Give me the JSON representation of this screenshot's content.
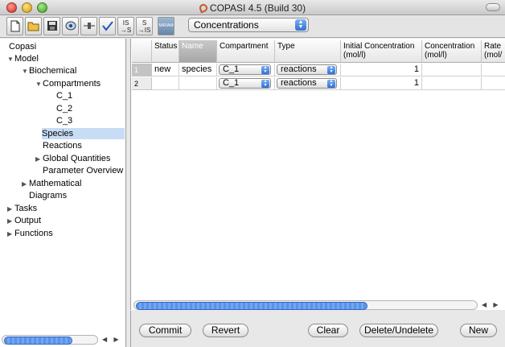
{
  "window": {
    "title": "COPASI 4.5 (Build 30)"
  },
  "toolbar": {
    "buttons": [
      {
        "name": "new-file-icon"
      },
      {
        "name": "open-folder-icon"
      },
      {
        "name": "save-icon"
      },
      {
        "name": "model-report-icon"
      },
      {
        "name": "slider-icon"
      },
      {
        "name": "check-model-icon"
      },
      {
        "name": "is-to-s-icon",
        "text1": "IS",
        "text2": "→S"
      },
      {
        "name": "s-to-is-icon",
        "text1": "S",
        "text2": "→IS"
      },
      {
        "name": "miriam-icon",
        "text": "MIRIAM"
      }
    ],
    "unit_select": "Concentrations"
  },
  "tree": {
    "items": [
      {
        "label": "Copasi",
        "tri": ""
      },
      {
        "label": "Model",
        "tri": "▼"
      },
      {
        "label": "Biochemical",
        "tri": "▼"
      },
      {
        "label": "Compartments",
        "tri": "▼"
      },
      {
        "label": "C_1",
        "tri": ""
      },
      {
        "label": "C_2",
        "tri": ""
      },
      {
        "label": "C_3",
        "tri": ""
      },
      {
        "label": "Species",
        "tri": ""
      },
      {
        "label": "Reactions",
        "tri": ""
      },
      {
        "label": "Global Quantities",
        "tri": "▶"
      },
      {
        "label": "Parameter Overview",
        "tri": ""
      },
      {
        "label": "Mathematical",
        "tri": "▶"
      },
      {
        "label": "Diagrams",
        "tri": ""
      },
      {
        "label": "Tasks",
        "tri": "▶"
      },
      {
        "label": "Output",
        "tri": "▶"
      },
      {
        "label": "Functions",
        "tri": "▶"
      }
    ]
  },
  "table": {
    "headers": [
      "Status",
      "Name",
      "Compartment",
      "Type",
      "Initial Concentration (mol/l)",
      "Concentration (mol/l)",
      "Rate (mol/"
    ],
    "rows": [
      {
        "num": "1",
        "status": "new",
        "name": "species",
        "compartment": "C_1",
        "type": "reactions",
        "initial": "1",
        "conc": "",
        "rate": ""
      },
      {
        "num": "2",
        "status": "",
        "name": "",
        "compartment": "C_1",
        "type": "reactions",
        "initial": "1",
        "conc": "",
        "rate": ""
      }
    ]
  },
  "buttons": {
    "commit": "Commit",
    "revert": "Revert",
    "clear": "Clear",
    "delete": "Delete/Undelete",
    "new": "New"
  },
  "scroll_arrows": "◀ ▶"
}
